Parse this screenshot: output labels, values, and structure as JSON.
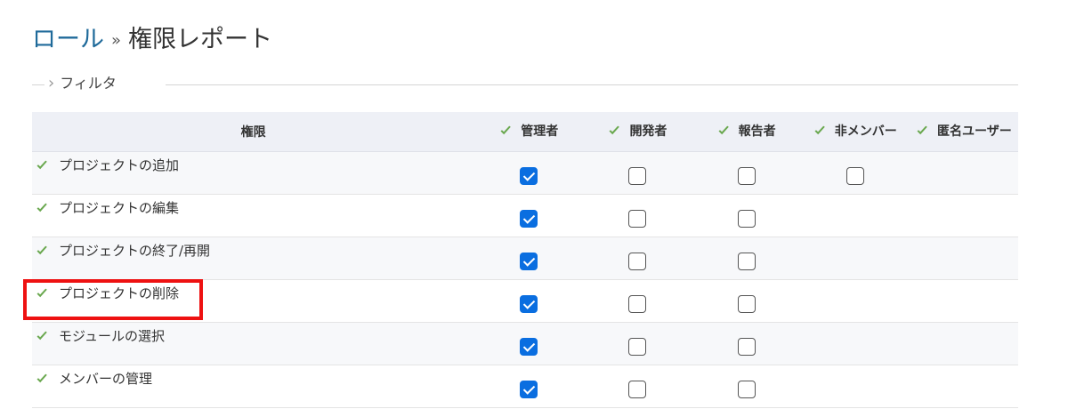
{
  "breadcrumb": {
    "parent": "ロール",
    "separator": "»",
    "current": "権限レポート"
  },
  "filter": {
    "label": "フィルタ",
    "icon": "chevron-right-icon"
  },
  "table": {
    "header_permission": "権限",
    "roles": [
      "管理者",
      "開発者",
      "報告者",
      "非メンバー",
      "匿名ユーザー"
    ],
    "rows": [
      {
        "name": "プロジェクトの追加",
        "states": [
          true,
          false,
          false,
          false,
          null
        ]
      },
      {
        "name": "プロジェクトの編集",
        "states": [
          true,
          false,
          false,
          null,
          null
        ]
      },
      {
        "name": "プロジェクトの終了/再開",
        "states": [
          true,
          false,
          false,
          null,
          null
        ]
      },
      {
        "name": "プロジェクトの削除",
        "states": [
          true,
          false,
          false,
          null,
          null
        ],
        "highlighted": true
      },
      {
        "name": "モジュールの選択",
        "states": [
          true,
          false,
          false,
          null,
          null
        ]
      },
      {
        "name": "メンバーの管理",
        "states": [
          true,
          false,
          false,
          null,
          null
        ]
      }
    ]
  },
  "colors": {
    "link": "#1f6a9a",
    "check_icon": "#6aa84f",
    "checkbox_checked": "#0a6ee0",
    "highlight": "#ee1111",
    "header_bg": "#eef0f6"
  }
}
